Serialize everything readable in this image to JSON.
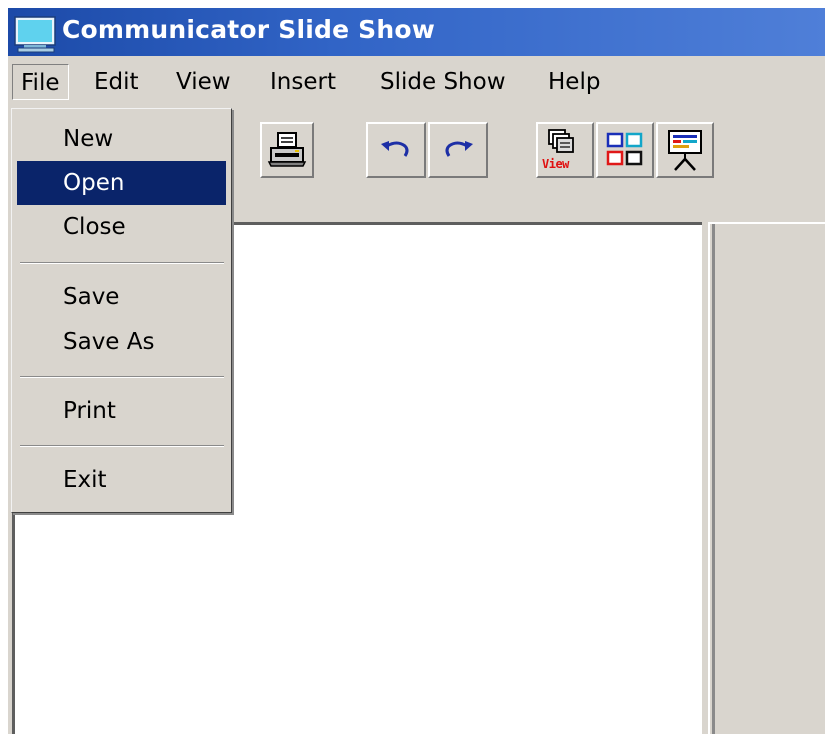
{
  "window": {
    "title": "Communicator Slide Show",
    "icon": "monitor-icon"
  },
  "menubar": {
    "items": [
      {
        "label": "File",
        "active": true
      },
      {
        "label": "Edit"
      },
      {
        "label": "View"
      },
      {
        "label": "Insert"
      },
      {
        "label": "Slide Show"
      },
      {
        "label": "Help"
      }
    ]
  },
  "toolbar": {
    "buttons": [
      {
        "icon": "printer-icon"
      },
      {
        "icon": "undo-icon"
      },
      {
        "icon": "redo-icon"
      },
      {
        "icon": "view-slides-icon"
      },
      {
        "icon": "layout-grid-icon"
      },
      {
        "icon": "presentation-icon"
      }
    ],
    "view_button_text": "View"
  },
  "file_menu": {
    "items": [
      {
        "label": "New"
      },
      {
        "label": "Open",
        "selected": true
      },
      {
        "label": "Close"
      },
      {
        "label": "Save"
      },
      {
        "label": "Save As"
      },
      {
        "label": "Print"
      },
      {
        "label": "Exit"
      }
    ]
  },
  "colors": {
    "title_bar": "#2a5bbf",
    "menu_highlight": "#0a246a",
    "window_face": "#d9d5ce"
  }
}
